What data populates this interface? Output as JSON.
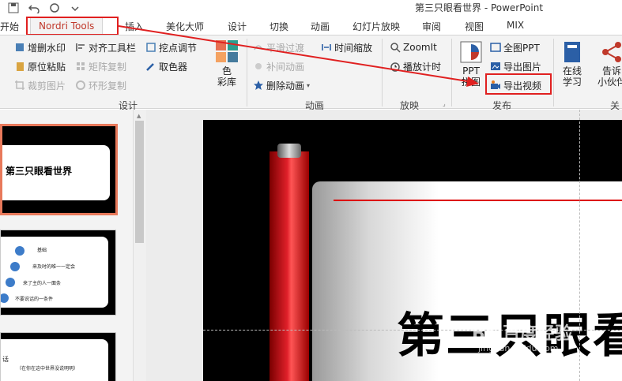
{
  "window": {
    "title": "第三只眼看世界 - PowerPoint"
  },
  "tabs": [
    {
      "label": "开始"
    },
    {
      "label": "Nordri Tools"
    },
    {
      "label": "插入"
    },
    {
      "label": "美化大师"
    },
    {
      "label": "设计"
    },
    {
      "label": "切换"
    },
    {
      "label": "动画"
    },
    {
      "label": "幻灯片放映"
    },
    {
      "label": "审阅"
    },
    {
      "label": "视图"
    },
    {
      "label": "MIX"
    }
  ],
  "groups": {
    "design": {
      "label": "设计",
      "btns": [
        "增删水印",
        "对齐工具栏",
        "挖点调节",
        "原位粘贴",
        "矩阵复制",
        "取色器",
        "裁剪图片",
        "环形复制"
      ],
      "big": "色\n彩库"
    },
    "animation": {
      "label": "动画",
      "btns": [
        "平滑过渡",
        "时间缩放",
        "补间动画",
        "删除动画"
      ]
    },
    "play": {
      "label": "放映",
      "btns": [
        "ZoomIt",
        "播放计时"
      ]
    },
    "publish": {
      "label": "发布",
      "big": "PPT\n拼图",
      "btns": [
        "全图PPT",
        "导出图片",
        "导出视频"
      ]
    },
    "learn": {
      "big1": "在线\n学习",
      "big2": "告诉\n小伙伴",
      "partial": "关于"
    }
  },
  "slide": {
    "title": "第三只眼看世界"
  },
  "thumbs": [
    {
      "title": "第三只眼看世界"
    },
    {
      "items": [
        "基础",
        "来及时的唯一一定会",
        "来了主的人一面条",
        "不要说话的一条件"
      ]
    },
    {
      "heading": "话",
      "sub": "（在你在这中世界没说明明）"
    }
  ],
  "watermark": {
    "text": "Bai百度经验",
    "sub": "jingyan.baidu.com"
  },
  "colors": {
    "accent": "#c0392b",
    "highlight": "#e02020",
    "ribbon": "#f3f3f3"
  }
}
